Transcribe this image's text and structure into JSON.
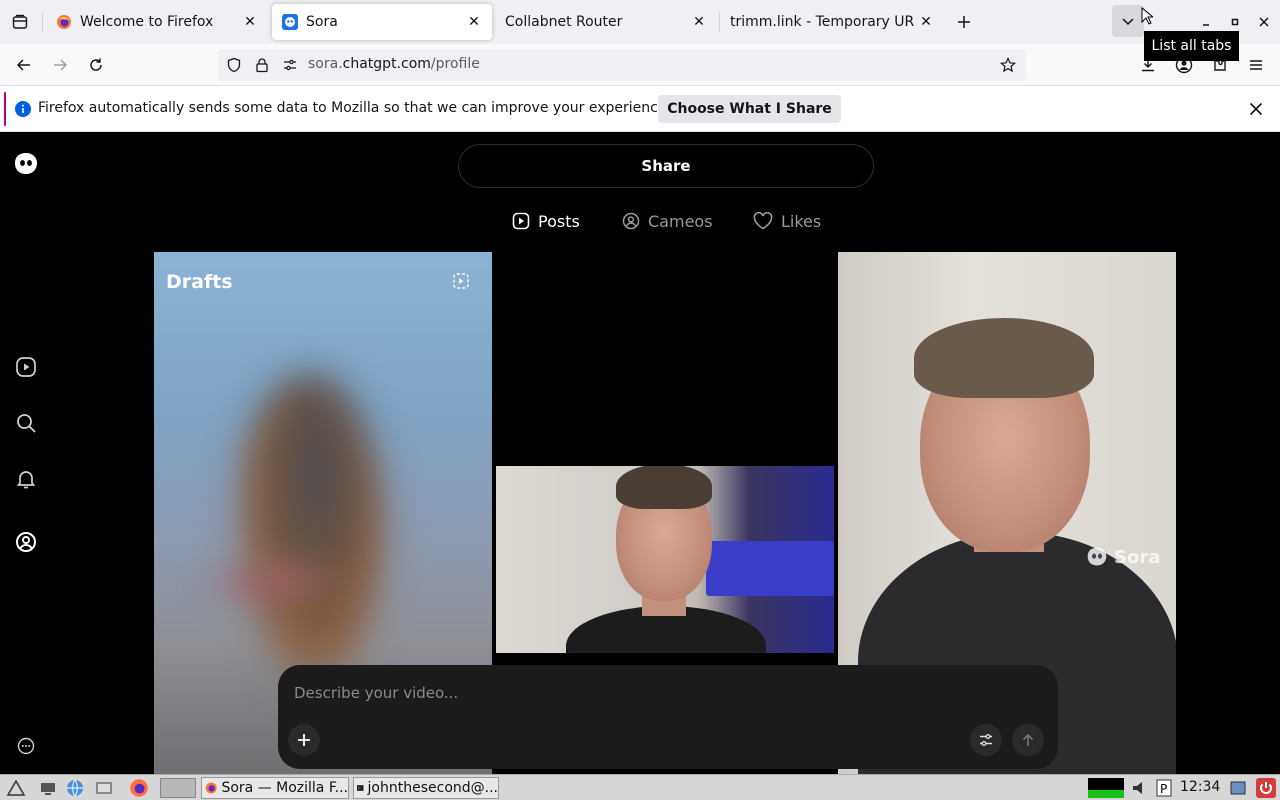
{
  "browser": {
    "tabs": [
      {
        "title": "Welcome to Firefox",
        "active": false
      },
      {
        "title": "Sora",
        "active": true
      },
      {
        "title": "Collabnet Router",
        "active": false
      },
      {
        "title": "trimm.link - Temporary URL",
        "active": false
      }
    ],
    "tooltip": "List all tabs",
    "url": {
      "prefix": "sora.",
      "domain": "chatgpt.com",
      "path": "/profile"
    },
    "notification": {
      "message": "Firefox automatically sends some data to Mozilla so that we can improve your experience.",
      "action": "Choose What I Share"
    }
  },
  "sora": {
    "share_label": "Share",
    "profile_tabs": [
      {
        "label": "Posts",
        "icon": "play-square-icon",
        "active": true
      },
      {
        "label": "Cameos",
        "icon": "user-circle-icon",
        "active": false
      },
      {
        "label": "Likes",
        "icon": "heart-icon",
        "active": false
      }
    ],
    "drafts_label": "Drafts",
    "watermark": "Sora",
    "composer": {
      "placeholder": "Describe your video..."
    }
  },
  "taskbar": {
    "windows": [
      {
        "label": "Sora — Mozilla F...",
        "icon": "firefox-icon"
      },
      {
        "label": "johnthesecond@...",
        "icon": "terminal-icon"
      }
    ],
    "clock": "12:34"
  },
  "colors": {
    "accent": "#0061e0",
    "page_bg": "#000000",
    "notification_bar": "#b5007f"
  }
}
